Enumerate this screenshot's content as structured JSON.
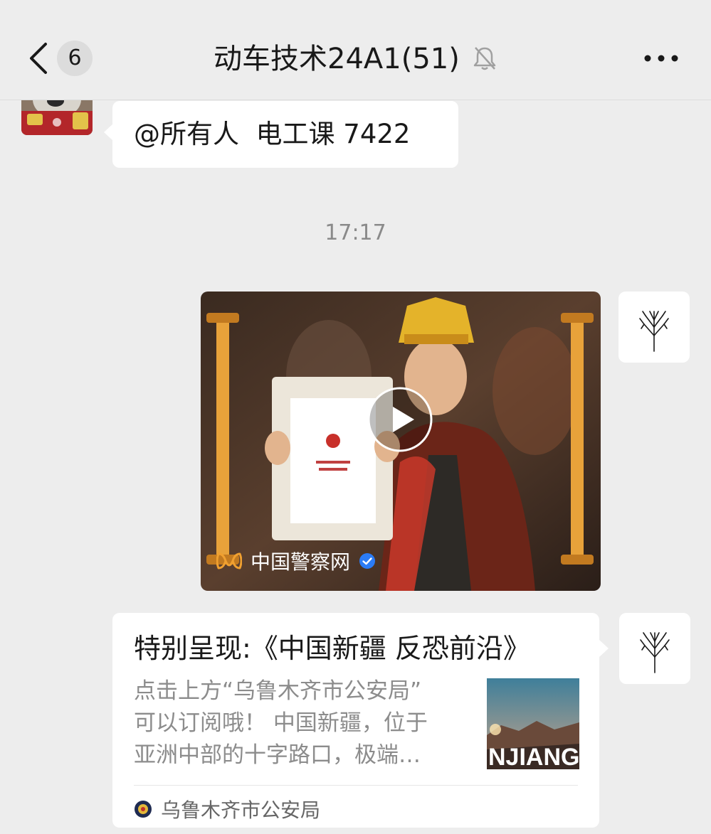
{
  "header": {
    "unread_count": "6",
    "title": "动车技术24A1(51)"
  },
  "messages": {
    "text_message": "@所有人  电工课 7422",
    "timestamp": "17:17",
    "video": {
      "source_name": "中国警察网"
    },
    "link_card": {
      "title": "特别呈现:《中国新疆 反恐前沿》",
      "description_lines": [
        "点击上方“乌鲁木齐市公安局”",
        "可以订阅哦！ 中国新疆，位于",
        "亚洲中部的十字路口，极端…"
      ],
      "thumb_text": "NJIANG",
      "source_name": "乌鲁木齐市公安局"
    }
  },
  "colors": {
    "background": "#ededed",
    "bubble": "#ffffff",
    "verified": "#2b7cf6",
    "accent_orange": "#e8a23a"
  }
}
